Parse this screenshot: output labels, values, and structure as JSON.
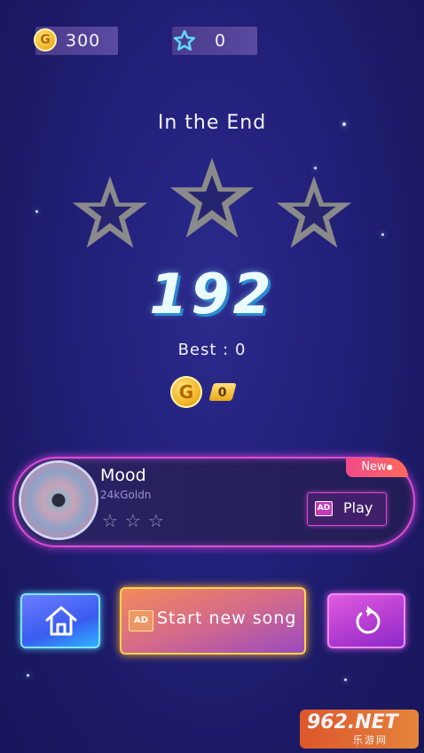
{
  "topbar": {
    "coins": "300",
    "stars": "0"
  },
  "song_title": "In the End",
  "score": "192",
  "best": "Best : 0",
  "reward_coins": "0",
  "next_song": {
    "name": "Mood",
    "artist": "24kGoldn",
    "tag": "New",
    "play_label": "Play",
    "ad_label": "AD"
  },
  "buttons": {
    "start_new_song": "Start new song",
    "ad_label": "AD"
  },
  "watermark": "962.NET",
  "colors": {
    "accent_pink": "#e24bd8",
    "coin_gold": "#f2b62a",
    "score_blue": "#2a8bd0"
  }
}
